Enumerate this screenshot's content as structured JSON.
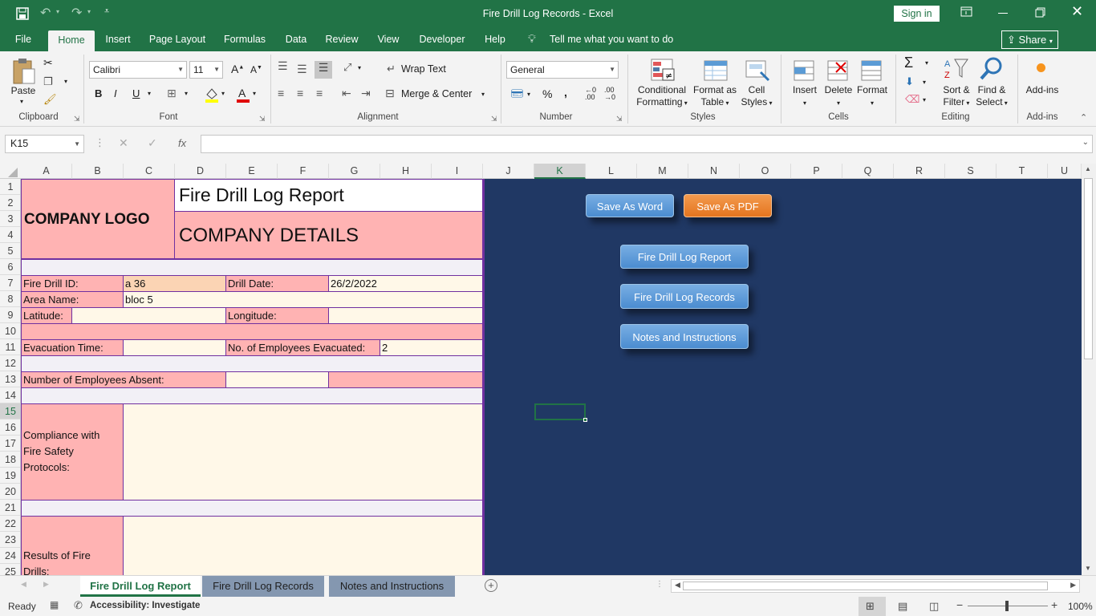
{
  "window": {
    "title": "Fire Drill Log Records  -  Excel",
    "sign_in": "Sign in"
  },
  "menu": {
    "tabs": [
      "File",
      "Home",
      "Insert",
      "Page Layout",
      "Formulas",
      "Data",
      "Review",
      "View",
      "Developer",
      "Help"
    ],
    "active_tab": "Home",
    "tell_me": "Tell me what you want to do",
    "share": "Share"
  },
  "ribbon": {
    "clipboard": {
      "label": "Clipboard",
      "paste": "Paste"
    },
    "font": {
      "label": "Font",
      "name": "Calibri",
      "size": "11"
    },
    "alignment": {
      "label": "Alignment",
      "wrap": "Wrap Text",
      "merge": "Merge & Center"
    },
    "number": {
      "label": "Number",
      "format": "General"
    },
    "styles": {
      "label": "Styles",
      "conditional": "Conditional",
      "formatting": "Formatting",
      "format_as": "Format as",
      "table": "Table",
      "cell": "Cell",
      "styles": "Styles"
    },
    "cells": {
      "label": "Cells",
      "insert": "Insert",
      "delete": "Delete",
      "format": "Format"
    },
    "editing": {
      "label": "Editing",
      "sort": "Sort &",
      "filter": "Filter",
      "find": "Find &",
      "select": "Select"
    },
    "addins": {
      "label": "Add-ins",
      "addins": "Add-ins"
    }
  },
  "formula_bar": {
    "name_box": "K15",
    "formula": ""
  },
  "columns": [
    "A",
    "B",
    "C",
    "D",
    "E",
    "F",
    "G",
    "H",
    "I",
    "J",
    "K",
    "L",
    "M",
    "N",
    "O",
    "P",
    "Q",
    "R",
    "S",
    "T",
    "U"
  ],
  "selected_column": "K",
  "rows": [
    "1",
    "2",
    "3",
    "4",
    "5",
    "6",
    "7",
    "8",
    "9",
    "10",
    "11",
    "12",
    "13",
    "14",
    "15",
    "16",
    "17",
    "18",
    "19",
    "20",
    "21",
    "22",
    "23",
    "24",
    "25"
  ],
  "selected_row": "15",
  "report": {
    "company_logo": "COMPANY LOGO",
    "title": "Fire Drill Log Report",
    "company_details": "COMPANY DETAILS",
    "fire_drill_id_label": "Fire Drill ID:",
    "fire_drill_id": "a 36",
    "drill_date_label": "Drill Date:",
    "drill_date": "26/2/2022",
    "area_name_label": "Area Name:",
    "area_name": "bloc 5",
    "latitude_label": "Latitude:",
    "latitude": "",
    "longitude_label": "Longitude:",
    "longitude": "",
    "evac_time_label": "Evacuation Time:",
    "evac_time": "",
    "employees_evacuated_label": "No. of Employees Evacuated:",
    "employees_evacuated": "2",
    "employees_absent_label": "Number of Employees Absent:",
    "employees_absent": "",
    "compliance_label_1": "Compliance with",
    "compliance_label_2": "Fire Safety",
    "compliance_label_3": "Protocols:",
    "results_label_1": "Results of Fire",
    "results_label_2": "Drills:"
  },
  "buttons": {
    "save_word": "Save As Word",
    "save_pdf": "Save As PDF",
    "report": "Fire Drill Log Report",
    "records": "Fire Drill Log Records",
    "notes": "Notes and Instructions"
  },
  "sheet_tabs": [
    "Fire Drill Log Report",
    "Fire Drill Log Records",
    "Notes and Instructions"
  ],
  "active_sheet": "Fire Drill Log Report",
  "status": {
    "ready": "Ready",
    "accessibility": "Accessibility: Investigate",
    "zoom": "100%"
  },
  "colors": {
    "excel_green": "#217346",
    "panel_navy": "#203864",
    "pink": "#ffb3b3",
    "cream": "#fff8e8",
    "border_purple": "#7030a0"
  }
}
